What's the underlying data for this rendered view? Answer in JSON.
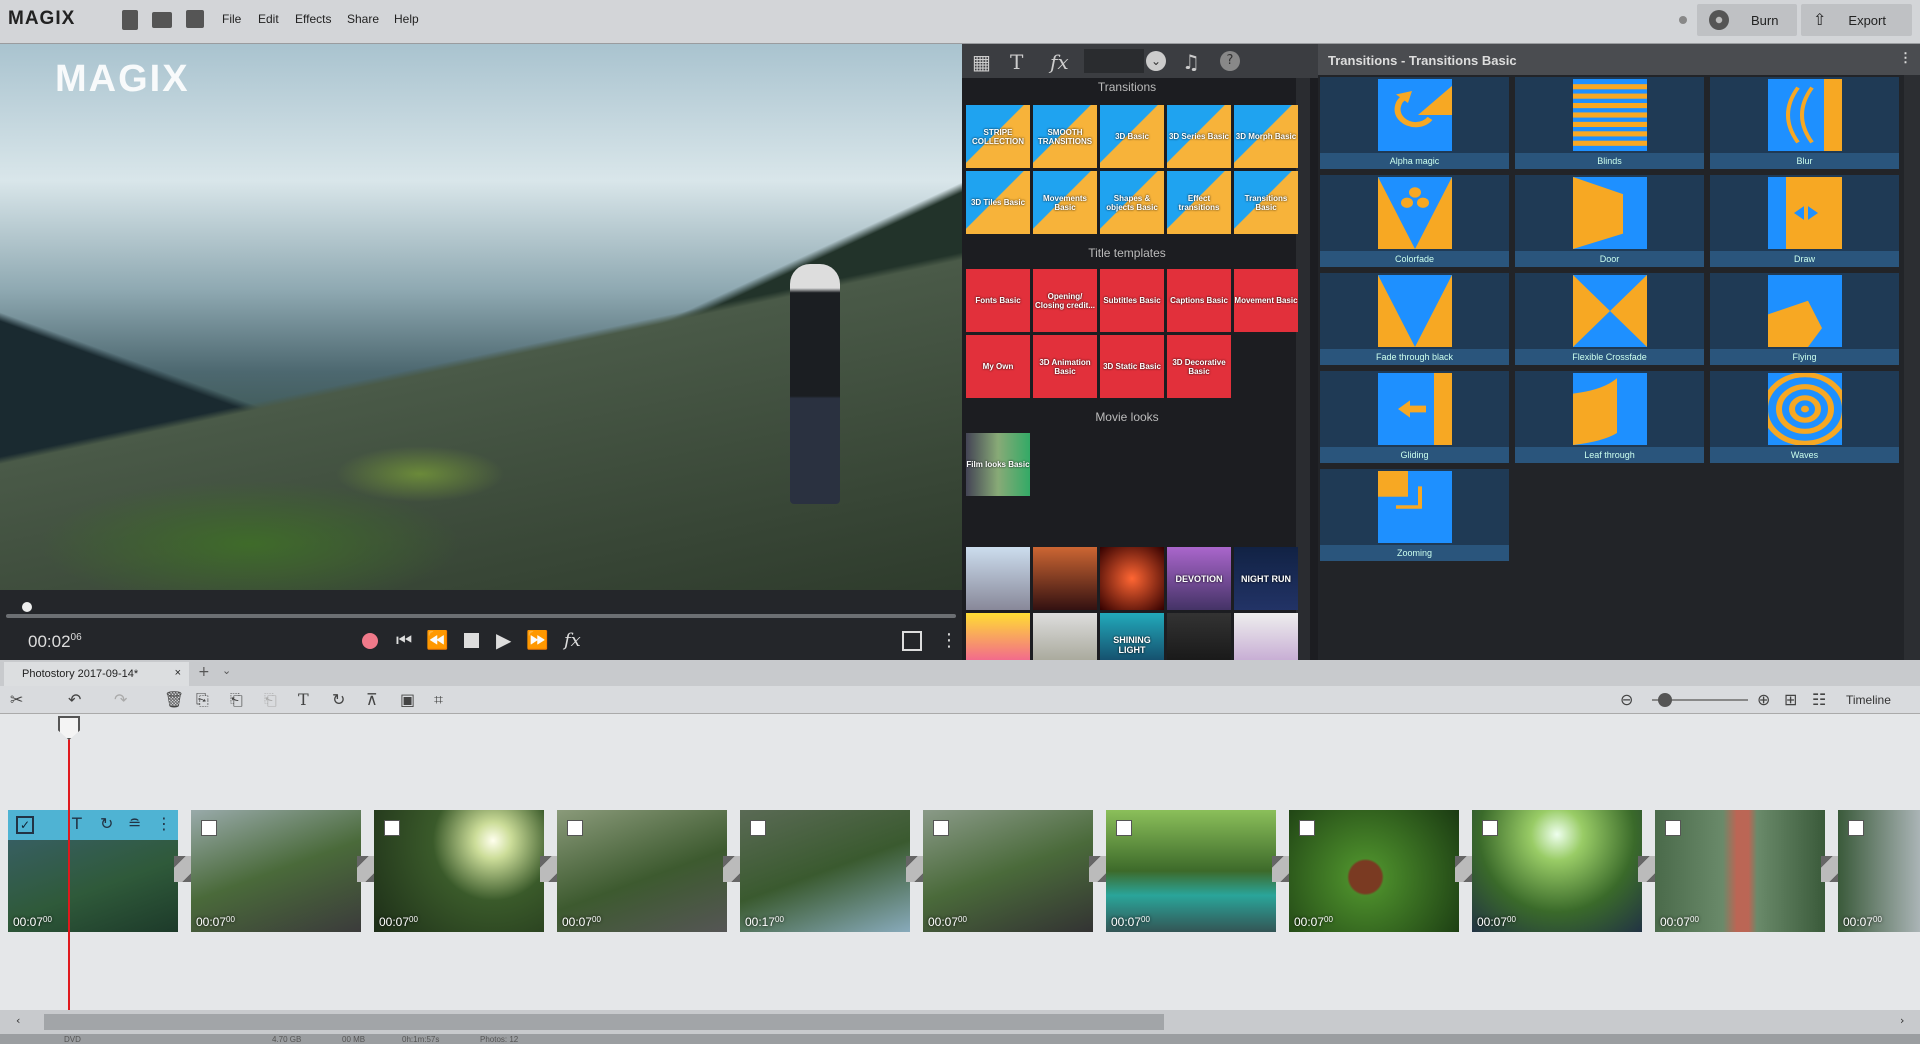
{
  "app": {
    "logo": "MAGIX",
    "watermark": "MAGIX"
  },
  "menu": [
    "File",
    "Edit",
    "Effects",
    "Share",
    "Help"
  ],
  "actions": {
    "burn": "Burn",
    "export": "Export"
  },
  "player": {
    "time": "00:02",
    "frames": "06"
  },
  "pool": {
    "transitions_heading": "Transitions",
    "transitions": [
      "STRIPE COLLECTION",
      "SMOOTH TRANSITIONS",
      "3D Basic",
      "3D Series Basic",
      "3D Morph Basic",
      "3D Tiles Basic",
      "Movements Basic",
      "Shapes & objects Basic",
      "Effect transitions",
      "Transitions Basic"
    ],
    "titles_heading": "Title templates",
    "titles": [
      "Fonts Basic",
      "Opening/ Closing credit...",
      "Subtitles Basic",
      "Captions Basic",
      "Movement Basic",
      "My Own",
      "3D Animation Basic",
      "3D Static Basic",
      "3D Decorative Basic"
    ],
    "looks_heading": "Movie looks",
    "looks": [
      "Film looks Basic"
    ],
    "music": [
      "",
      "",
      "",
      "DEVOTION",
      "NIGHT RUN",
      "",
      "",
      "SHINING LIGHT",
      "",
      ""
    ]
  },
  "right_panel": {
    "title": "Transitions - Transitions Basic",
    "items": [
      {
        "label": "Alpha magic",
        "icon": "alpha"
      },
      {
        "label": "Blinds",
        "icon": "blinds"
      },
      {
        "label": "Blur",
        "icon": "blur"
      },
      {
        "label": "Colorfade",
        "icon": "colorfade"
      },
      {
        "label": "Door",
        "icon": "door"
      },
      {
        "label": "Draw",
        "icon": "draw"
      },
      {
        "label": "Fade through black",
        "icon": "fade"
      },
      {
        "label": "Flexible Crossfade",
        "icon": "cross"
      },
      {
        "label": "Flying",
        "icon": "flying"
      },
      {
        "label": "Gliding",
        "icon": "gliding"
      },
      {
        "label": "Leaf through",
        "icon": "leaf"
      },
      {
        "label": "Waves",
        "icon": "waves"
      },
      {
        "label": "Zooming",
        "icon": "zoom"
      }
    ]
  },
  "project_tab": "Photostory 2017-09-14*",
  "timeline_label": "Timeline",
  "clips": [
    {
      "time": "00:07",
      "frames": "00",
      "selected": true
    },
    {
      "time": "00:07",
      "frames": "00"
    },
    {
      "time": "00:07",
      "frames": "00"
    },
    {
      "time": "00:07",
      "frames": "00"
    },
    {
      "time": "00:17",
      "frames": "00"
    },
    {
      "time": "00:07",
      "frames": "00"
    },
    {
      "time": "00:07",
      "frames": "00"
    },
    {
      "time": "00:07",
      "frames": "00"
    },
    {
      "time": "00:07",
      "frames": "00"
    },
    {
      "time": "00:07",
      "frames": "00"
    },
    {
      "time": "00:07",
      "frames": "00"
    }
  ],
  "status": [
    "DVD",
    "4.70 GB",
    "00 MB",
    "0h:1m:57s",
    "Photos: 12"
  ],
  "colors": {
    "accent_blue": "#1e90ff",
    "accent_orange": "#f7a823",
    "title_red": "#e2303b",
    "playhead": "#e0191d"
  }
}
